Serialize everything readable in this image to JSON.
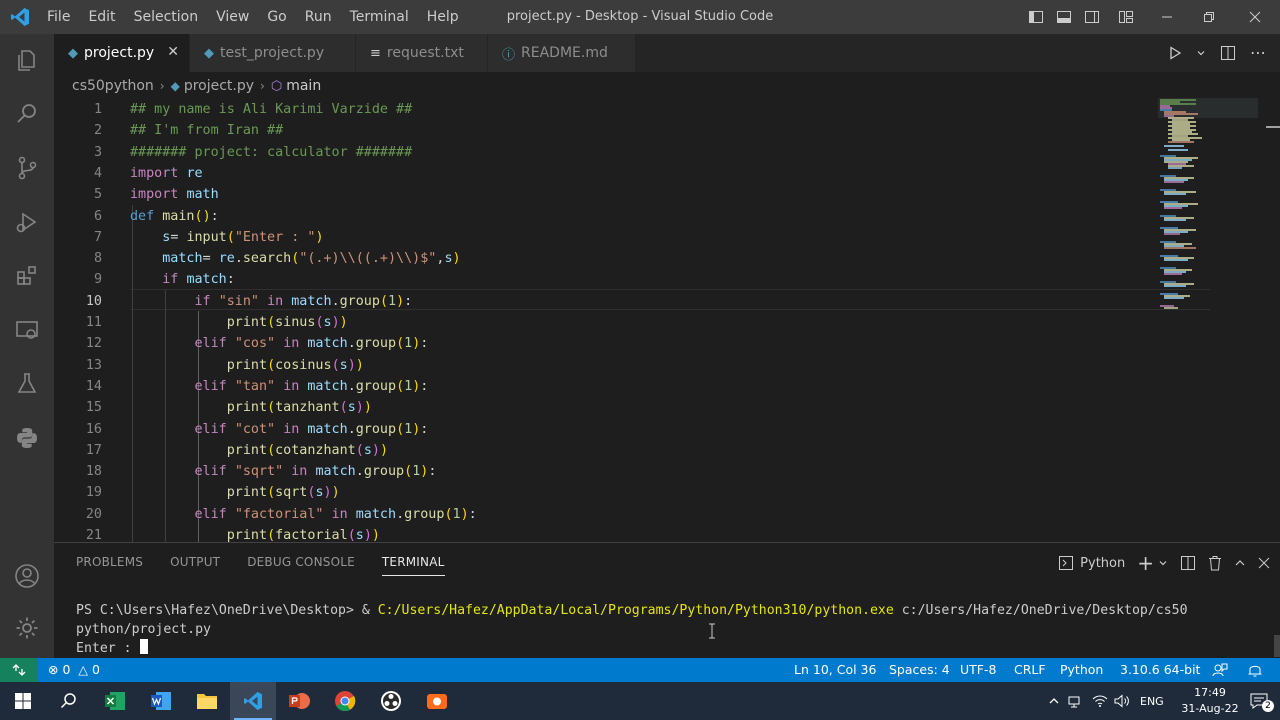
{
  "window": {
    "title": "project.py - Desktop - Visual Studio Code",
    "menu": [
      "File",
      "Edit",
      "Selection",
      "View",
      "Go",
      "Run",
      "Terminal",
      "Help"
    ]
  },
  "tabs": [
    {
      "label": "project.py",
      "icon": "python-file-icon",
      "active": true
    },
    {
      "label": "test_project.py",
      "icon": "python-file-icon",
      "active": false
    },
    {
      "label": "request.txt",
      "icon": "text-file-icon",
      "active": false
    },
    {
      "label": "README.md",
      "icon": "info-icon",
      "active": false
    }
  ],
  "breadcrumb": {
    "folder": "cs50python",
    "file": "project.py",
    "symbol": "main"
  },
  "editor": {
    "current_line": 10,
    "lines": [
      {
        "no": "1",
        "code": "## my name is Ali Karimi Varzide ##"
      },
      {
        "no": "2",
        "code": "## I'm from Iran ##"
      },
      {
        "no": "3",
        "code": "####### project: calculator #######"
      },
      {
        "no": "4",
        "code": "import re"
      },
      {
        "no": "5",
        "code": "import math"
      },
      {
        "no": "6",
        "code": "def main():"
      },
      {
        "no": "7",
        "code": "    s= input(\"Enter : \")"
      },
      {
        "no": "8",
        "code": "    match= re.search(\"(.+)\\\\((.+)\\\\)$\",s)"
      },
      {
        "no": "9",
        "code": "    if match:"
      },
      {
        "no": "10",
        "code": "        if \"sin\" in match.group(1):"
      },
      {
        "no": "11",
        "code": "            print(sinus(s))"
      },
      {
        "no": "12",
        "code": "        elif \"cos\" in match.group(1):"
      },
      {
        "no": "13",
        "code": "            print(cosinus(s))"
      },
      {
        "no": "14",
        "code": "        elif \"tan\" in match.group(1):"
      },
      {
        "no": "15",
        "code": "            print(tanzhant(s))"
      },
      {
        "no": "16",
        "code": "        elif \"cot\" in match.group(1):"
      },
      {
        "no": "17",
        "code": "            print(cotanzhant(s))"
      },
      {
        "no": "18",
        "code": "        elif \"sqrt\" in match.group(1):"
      },
      {
        "no": "19",
        "code": "            print(sqrt(s))"
      },
      {
        "no": "20",
        "code": "        elif \"factorial\" in match.group(1):"
      },
      {
        "no": "21",
        "code": "            print(factorial(s))"
      }
    ]
  },
  "panel": {
    "tabs": [
      "PROBLEMS",
      "OUTPUT",
      "DEBUG CONSOLE",
      "TERMINAL"
    ],
    "active_tab": "TERMINAL",
    "shell": "Python",
    "terminal": {
      "prompt": "PS C:\\Users\\Hafez\\OneDrive\\Desktop> & ",
      "exe": "C:/Users/Hafez/AppData/Local/Programs/Python/Python310/python.exe",
      "arg1": " c:/Users/Hafez/OneDrive/Desktop/cs50",
      "arg2": "python/project.py",
      "input_prompt": "Enter : "
    }
  },
  "status": {
    "errors": "0",
    "warnings": "0",
    "position": "Ln 10, Col 36",
    "spaces": "Spaces: 4",
    "encoding": "UTF-8",
    "eol": "CRLF",
    "language": "Python",
    "interpreter": "3.10.6 64-bit"
  },
  "taskbar": {
    "lang": "ENG",
    "time": "17:49",
    "date": "31-Aug-22"
  },
  "colors": {
    "accent": "#007acc",
    "remote": "#16825d",
    "activity_bar": "#333333",
    "editor_bg": "#1e1e1e"
  }
}
